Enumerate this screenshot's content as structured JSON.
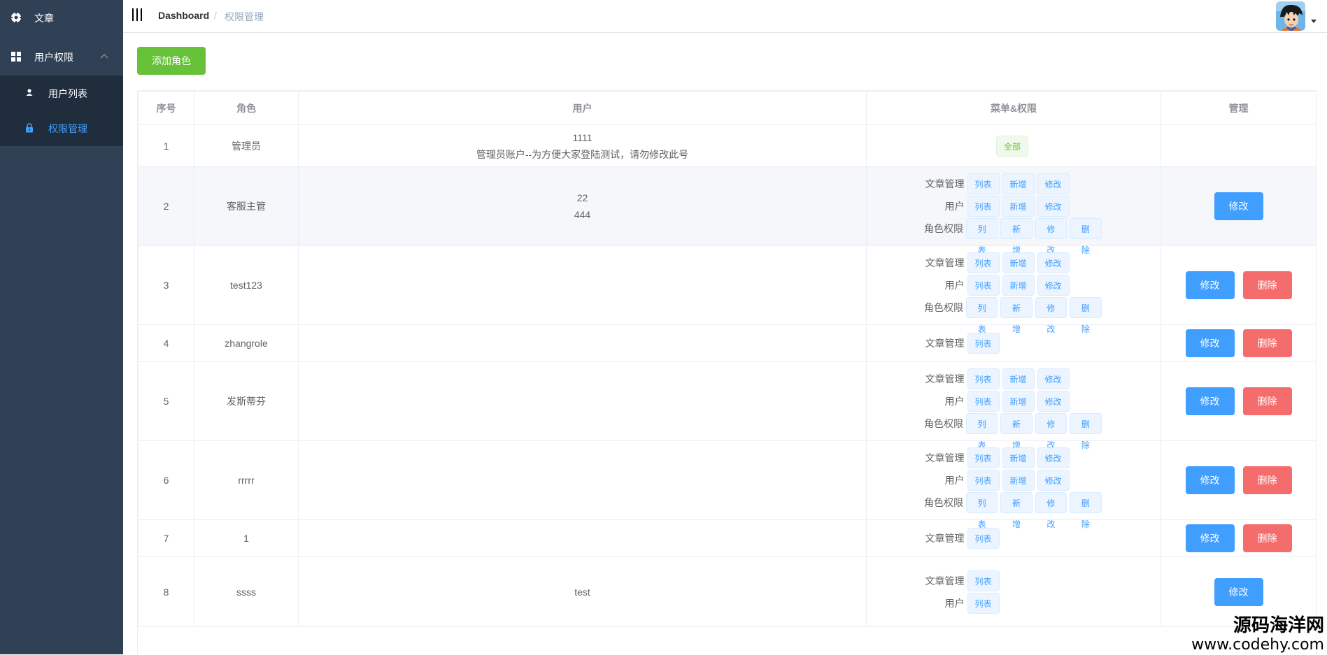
{
  "sidebar": {
    "article_label": "文章",
    "users_label": "用户权限",
    "sub_items": [
      {
        "label": "用户列表"
      },
      {
        "label": "权限管理"
      }
    ]
  },
  "navbar": {
    "breadcrumb_home": "Dashboard",
    "breadcrumb_sep": "/",
    "breadcrumb_current": "权限管理"
  },
  "toolbar": {
    "add_label": "添加角色"
  },
  "table": {
    "headers": [
      "序号",
      "角色",
      "用户",
      "菜单&权限",
      "管理"
    ],
    "tag_all": "全部",
    "edit_label": "修改",
    "delete_label": "删除",
    "rows": [
      {
        "index": "1",
        "role": "管理员",
        "users": [
          "1111",
          "管理员账户--为方便大家登陆测试，请勿修改此号"
        ],
        "all": true,
        "perms": [],
        "edit": false,
        "delete": false
      },
      {
        "index": "2",
        "role": "客服主管",
        "users": [
          "22",
          "444"
        ],
        "all": false,
        "perms": [
          {
            "menu": "文章管理",
            "actions": [
              "列表",
              "新增",
              "修改"
            ]
          },
          {
            "menu": "用户",
            "actions": [
              "列表",
              "新增",
              "修改"
            ]
          },
          {
            "menu": "角色权限",
            "actions": [
              "列表",
              "新增",
              "修改",
              "删除"
            ]
          }
        ],
        "edit": true,
        "delete": false
      },
      {
        "index": "3",
        "role": "test123",
        "users": [],
        "all": false,
        "perms": [
          {
            "menu": "文章管理",
            "actions": [
              "列表",
              "新增",
              "修改"
            ]
          },
          {
            "menu": "用户",
            "actions": [
              "列表",
              "新增",
              "修改"
            ]
          },
          {
            "menu": "角色权限",
            "actions": [
              "列表",
              "新增",
              "修改",
              "删除"
            ]
          }
        ],
        "edit": true,
        "delete": true
      },
      {
        "index": "4",
        "role": "zhangrole",
        "users": [],
        "all": false,
        "perms": [
          {
            "menu": "文章管理",
            "actions": [
              "列表"
            ]
          }
        ],
        "edit": true,
        "delete": true
      },
      {
        "index": "5",
        "role": "发斯蒂芬",
        "users": [],
        "all": false,
        "perms": [
          {
            "menu": "文章管理",
            "actions": [
              "列表",
              "新增",
              "修改"
            ]
          },
          {
            "menu": "用户",
            "actions": [
              "列表",
              "新增",
              "修改"
            ]
          },
          {
            "menu": "角色权限",
            "actions": [
              "列表",
              "新增",
              "修改",
              "删除"
            ]
          }
        ],
        "edit": true,
        "delete": true
      },
      {
        "index": "6",
        "role": "rrrrr",
        "users": [],
        "all": false,
        "perms": [
          {
            "menu": "文章管理",
            "actions": [
              "列表",
              "新增",
              "修改"
            ]
          },
          {
            "menu": "用户",
            "actions": [
              "列表",
              "新增",
              "修改"
            ]
          },
          {
            "menu": "角色权限",
            "actions": [
              "列表",
              "新增",
              "修改",
              "删除"
            ]
          }
        ],
        "edit": true,
        "delete": true
      },
      {
        "index": "7",
        "role": "1",
        "users": [],
        "all": false,
        "perms": [
          {
            "menu": "文章管理",
            "actions": [
              "列表"
            ]
          }
        ],
        "edit": true,
        "delete": true
      },
      {
        "index": "8",
        "role": "ssss",
        "users": [
          "test"
        ],
        "all": false,
        "perms": [
          {
            "menu": "文章管理",
            "actions": [
              "列表"
            ]
          },
          {
            "menu": "用户",
            "actions": [
              "列表"
            ]
          }
        ],
        "edit": true,
        "delete": false
      }
    ]
  },
  "watermark": {
    "line1": "源码海洋网",
    "line2": "www.codehy.com"
  }
}
